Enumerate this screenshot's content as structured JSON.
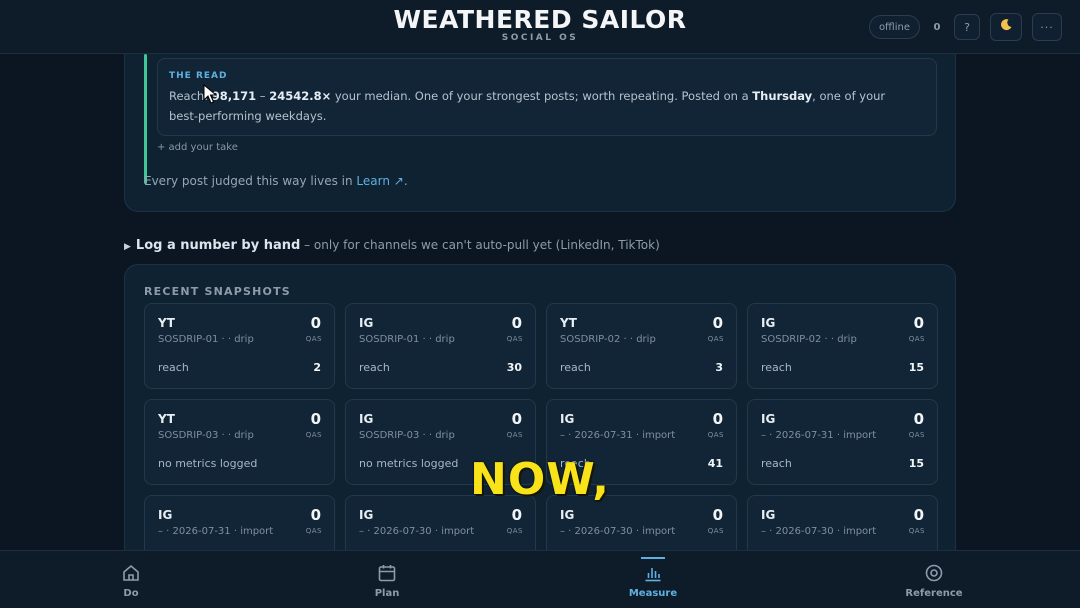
{
  "header": {
    "title": "WEATHERED SAILOR",
    "subtitle": "SOCIAL OS",
    "status_pill": "offline",
    "count": "0",
    "help_label": "?",
    "theme_icon": "moon-icon",
    "more_label": "···"
  },
  "read": {
    "label": "THE READ",
    "reach_prefix": "Reach: ",
    "reach_value": "98,171",
    "dash": " – ",
    "multiplier": "24542.8×",
    "median_text": " your median. One of your strongest posts; worth repeating. Posted on a ",
    "weekday": "Thursday",
    "suffix": ", one of your best-performing weekdays.",
    "add_take": "+ add your take",
    "learn_prefix": "Every post judged this way lives in ",
    "learn_link": "Learn ↗",
    "learn_suffix": "."
  },
  "log": {
    "title": "Log a number by hand",
    "note": "– only for channels we can't auto-pull yet (LinkedIn, TikTok)"
  },
  "snapshots": {
    "title": "RECENT SNAPSHOTS",
    "qas_label": "QAS",
    "tiles": [
      {
        "platform": "YT",
        "sub": "SOSDRIP-01 · · drip",
        "qas": "0",
        "metric": "reach",
        "value": "2"
      },
      {
        "platform": "IG",
        "sub": "SOSDRIP-01 · · drip",
        "qas": "0",
        "metric": "reach",
        "value": "30"
      },
      {
        "platform": "YT",
        "sub": "SOSDRIP-02 · · drip",
        "qas": "0",
        "metric": "reach",
        "value": "3"
      },
      {
        "platform": "IG",
        "sub": "SOSDRIP-02 · · drip",
        "qas": "0",
        "metric": "reach",
        "value": "15"
      },
      {
        "platform": "YT",
        "sub": "SOSDRIP-03 · · drip",
        "qas": "0",
        "metric": "no metrics logged",
        "value": ""
      },
      {
        "platform": "IG",
        "sub": "SOSDRIP-03 · · drip",
        "qas": "0",
        "metric": "no metrics logged",
        "value": ""
      },
      {
        "platform": "IG",
        "sub": "– · 2026-07-31 · import",
        "qas": "0",
        "metric": "reach",
        "value": "41"
      },
      {
        "platform": "IG",
        "sub": "– · 2026-07-31 · import",
        "qas": "0",
        "metric": "reach",
        "value": "15"
      },
      {
        "platform": "IG",
        "sub": "– · 2026-07-31 · import",
        "qas": "0",
        "metric": "",
        "value": ""
      },
      {
        "platform": "IG",
        "sub": "– · 2026-07-30 · import",
        "qas": "0",
        "metric": "",
        "value": ""
      },
      {
        "platform": "IG",
        "sub": "– · 2026-07-30 · import",
        "qas": "0",
        "metric": "",
        "value": ""
      },
      {
        "platform": "IG",
        "sub": "– · 2026-07-30 · import",
        "qas": "0",
        "metric": "",
        "value": ""
      }
    ]
  },
  "caption": "NOW,",
  "nav": {
    "items": [
      {
        "label": "Do",
        "icon": "home-icon"
      },
      {
        "label": "Plan",
        "icon": "calendar-icon"
      },
      {
        "label": "Measure",
        "icon": "chart-icon",
        "active": true
      },
      {
        "label": "Reference",
        "icon": "target-icon"
      }
    ]
  }
}
